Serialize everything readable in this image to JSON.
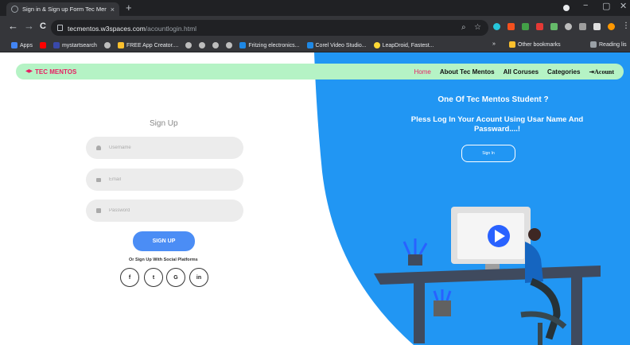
{
  "browser": {
    "tab_title": "Sign in & Sign up Form Tec Ment",
    "tab_close": "×",
    "new_tab": "+",
    "win_min": "−",
    "win_max": "▢",
    "win_close": "✕",
    "back": "←",
    "forward": "→",
    "reload": "C",
    "url_host": "tecmentos.w3spaces.com",
    "url_path": "/acountlogin.html",
    "search_icon": "search-icon",
    "star_icon": "star-icon"
  },
  "bookmarks": {
    "items": [
      {
        "label": "Apps",
        "color": "#4285f4"
      },
      {
        "label": "",
        "color": "#ff0000"
      },
      {
        "label": "mystartsearch",
        "color": "#3949ab"
      },
      {
        "label": "",
        "color": "#bdbdbd"
      },
      {
        "label": "FREE App Creator....",
        "color": "#fbc02d"
      },
      {
        "label": "",
        "color": "#bdbdbd"
      },
      {
        "label": "",
        "color": "#bdbdbd"
      },
      {
        "label": "",
        "color": "#bdbdbd"
      },
      {
        "label": "",
        "color": "#bdbdbd"
      },
      {
        "label": "Fritzing electronics...",
        "color": "#1e88e5"
      },
      {
        "label": "Corel Video Studio...",
        "color": "#1e88e5"
      },
      {
        "label": "LeapDroid, Fastest...",
        "color": "#fdd835"
      }
    ],
    "overflow": "»",
    "other": "Other bookmarks",
    "reading": "Reading lis"
  },
  "navbar": {
    "brand": "TEC MENTOS",
    "links": [
      "Home",
      "About Tec Mentos",
      "All Coruses",
      "Categories",
      "Acount"
    ]
  },
  "signup": {
    "title": "Sign Up",
    "username_placeholder": "Username",
    "email_placeholder": "Email",
    "password_placeholder": "Password",
    "button": "SIGN UP",
    "social_text": "Or Sign Up With Social Platforms",
    "social": [
      "f",
      "t",
      "G",
      "in"
    ]
  },
  "signin": {
    "heading": "One Of Tec Mentos Student ?",
    "message_line1": "Pless Log In Your Acount Using Usar Name And",
    "message_line2": "Passward....!",
    "button": "Sign In"
  },
  "colors": {
    "blue": "#2196f3",
    "brand": "#e81e63",
    "navbar": "#b5f3c5",
    "signup_button": "#4b8df5"
  }
}
